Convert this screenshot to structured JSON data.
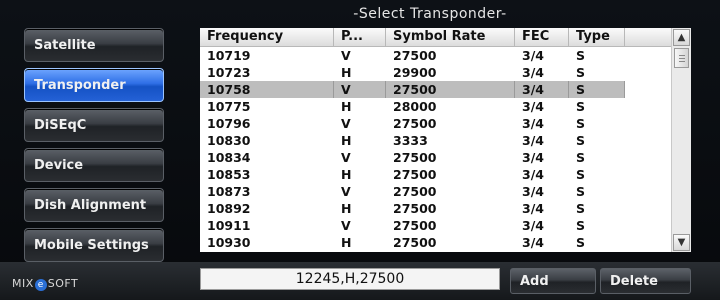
{
  "title": "-Select Transponder-",
  "sidebar": {
    "items": [
      {
        "label": "Satellite",
        "active": false
      },
      {
        "label": "Transponder",
        "active": true
      },
      {
        "label": "DiSEqC",
        "active": false
      },
      {
        "label": "Device",
        "active": false
      },
      {
        "label": "Dish Alignment",
        "active": false
      },
      {
        "label": "Mobile Settings",
        "active": false
      }
    ]
  },
  "table": {
    "headers": [
      "Frequency",
      "P...",
      "Symbol Rate",
      "FEC",
      "Type"
    ],
    "selected_index": 2,
    "rows": [
      [
        "10719",
        "V",
        "27500",
        "3/4",
        "S"
      ],
      [
        "10723",
        "H",
        "29900",
        "3/4",
        "S"
      ],
      [
        "10758",
        "V",
        "27500",
        "3/4",
        "S"
      ],
      [
        "10775",
        "H",
        "28000",
        "3/4",
        "S"
      ],
      [
        "10796",
        "V",
        "27500",
        "3/4",
        "S"
      ],
      [
        "10830",
        "H",
        "3333",
        "3/4",
        "S"
      ],
      [
        "10834",
        "V",
        "27500",
        "3/4",
        "S"
      ],
      [
        "10853",
        "H",
        "27500",
        "3/4",
        "S"
      ],
      [
        "10873",
        "V",
        "27500",
        "3/4",
        "S"
      ],
      [
        "10892",
        "H",
        "27500",
        "3/4",
        "S"
      ],
      [
        "10911",
        "V",
        "27500",
        "3/4",
        "S"
      ],
      [
        "10930",
        "H",
        "27500",
        "3/4",
        "S"
      ]
    ]
  },
  "input": {
    "value": "12245,H,27500"
  },
  "buttons": {
    "add": "Add",
    "delete": "Delete"
  },
  "brand": {
    "prefix": "MIX",
    "mark": "e",
    "suffix": "SOFT"
  },
  "colors": {
    "accent": "#2f6fe6",
    "selected_row": "#bdbdbd"
  }
}
